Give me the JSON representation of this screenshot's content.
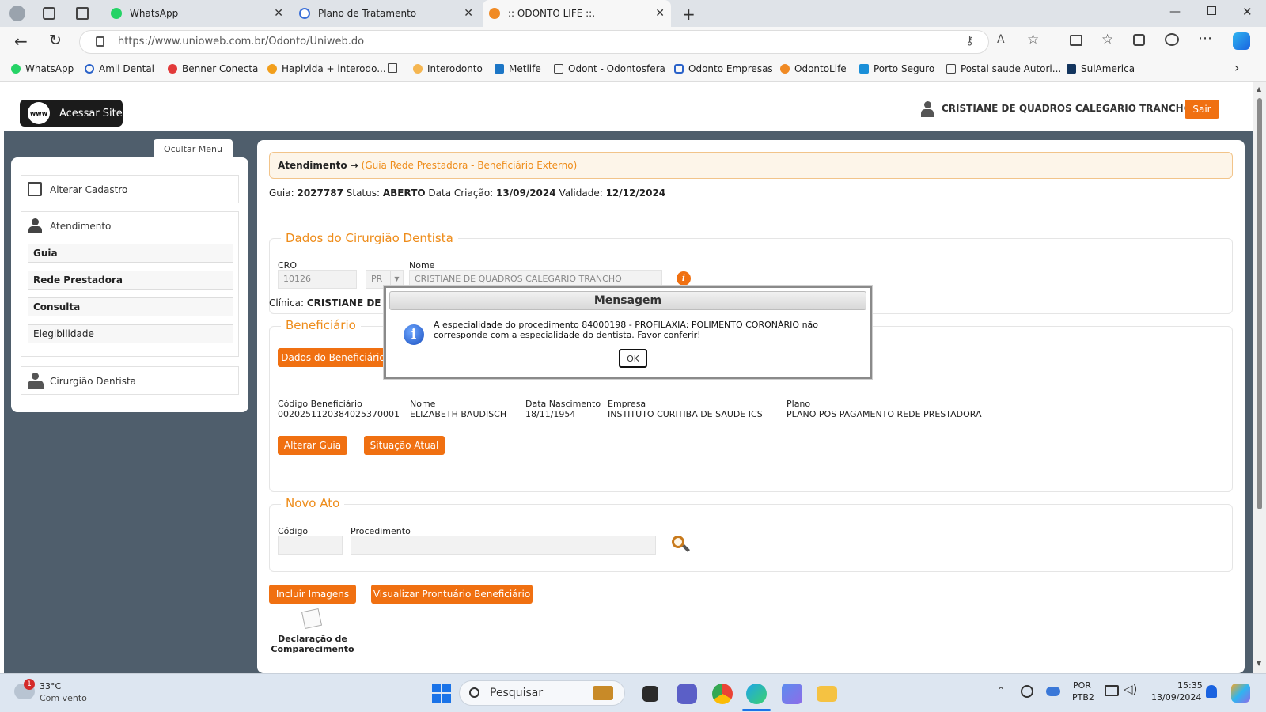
{
  "browser": {
    "tabs": [
      {
        "label": "WhatsApp",
        "icon": "whatsapp-icon"
      },
      {
        "label": "Plano de Tratamento",
        "icon": "edge-page-icon"
      },
      {
        "label": ":: ODONTO LIFE ::.",
        "icon": "odontolife-icon",
        "active": true
      }
    ],
    "url": "https://www.unioweb.com.br/Odonto/Uniweb.do",
    "bookmarks": [
      "WhatsApp",
      "Amil Dental",
      "Benner Conecta",
      "Hapivida + interodo...",
      "Interodonto",
      "Metlife",
      "Odont - Odontosfera",
      "Odonto Empresas",
      "OdontoLife",
      "Porto Seguro",
      "Postal saude Autori...",
      "SulAmerica"
    ]
  },
  "header": {
    "site_button": "Acessar Site",
    "www_badge": "www",
    "user_name": "CRISTIANE DE QUADROS CALEGARIO TRANCHO",
    "logout": "Sair"
  },
  "sidebar": {
    "toggle": "Ocultar Menu",
    "items": [
      {
        "label": "Alterar Cadastro"
      },
      {
        "label": "Atendimento",
        "sub": [
          "Guia",
          "Rede Prestadora",
          "Consulta",
          "Elegibilidade"
        ]
      },
      {
        "label": "Cirurgião Dentista"
      }
    ]
  },
  "main": {
    "breadcrumb_main": "Atendimento →",
    "breadcrumb_sub": "(Guia Rede Prestadora - Beneficiário Externo)",
    "guia_label": "Guia:",
    "guia": "2027787",
    "status_label": "Status:",
    "status": "ABERTO",
    "criacao_label": "Data Criação:",
    "criacao": "13/09/2024",
    "validade_label": "Validade:",
    "validade": "12/12/2024",
    "dentista": {
      "legend": "Dados do Cirurgião Dentista",
      "cro_label": "CRO",
      "cro": "10126",
      "uf": "PR",
      "nome_label": "Nome",
      "nome": "CRISTIANE DE QUADROS CALEGARIO TRANCHO",
      "clinica_label": "Clínica:",
      "clinica": "CRISTIANE DE"
    },
    "beneficiario": {
      "legend": "Beneficiário",
      "button": "Dados do Beneficiário",
      "codigo_label": "Código Beneficiário",
      "codigo": "0020251120384025370001",
      "nome_label": "Nome",
      "nome": "ELIZABETH BAUDISCH",
      "nasc_label": "Data Nascimento",
      "nasc": "18/11/1954",
      "empresa_label": "Empresa",
      "empresa": "INSTITUTO CURITIBA DE SAUDE ICS",
      "plano_label": "Plano",
      "plano": "PLANO POS PAGAMENTO REDE PRESTADORA",
      "alterar": "Alterar Guia",
      "situacao": "Situação Atual"
    },
    "novo_ato": {
      "legend": "Novo Ato",
      "codigo_label": "Código",
      "procedimento_label": "Procedimento"
    },
    "incluir": "Incluir Imagens",
    "prontuario": "Visualizar Prontuário Beneficiário",
    "declaracao_1": "Declaração de",
    "declaracao_2": "Comparecimento"
  },
  "dialog": {
    "title": "Mensagem",
    "line1": "A especialidade do procedimento 84000198 - PROFILAXIA: POLIMENTO CORONÁRIO não",
    "line2": "corresponde com a especialidade do dentista. Favor conferir!",
    "ok": "OK"
  },
  "taskbar": {
    "temp": "33°C",
    "weather": "Com vento",
    "badge": "1",
    "search": "Pesquisar",
    "lang": "POR",
    "layout": "PTB2",
    "time": "15:35",
    "date": "13/09/2024"
  },
  "colors": {
    "accent": "#f07011",
    "legend": "#ee8c1a",
    "dark_pane": "#4f5e6c"
  }
}
